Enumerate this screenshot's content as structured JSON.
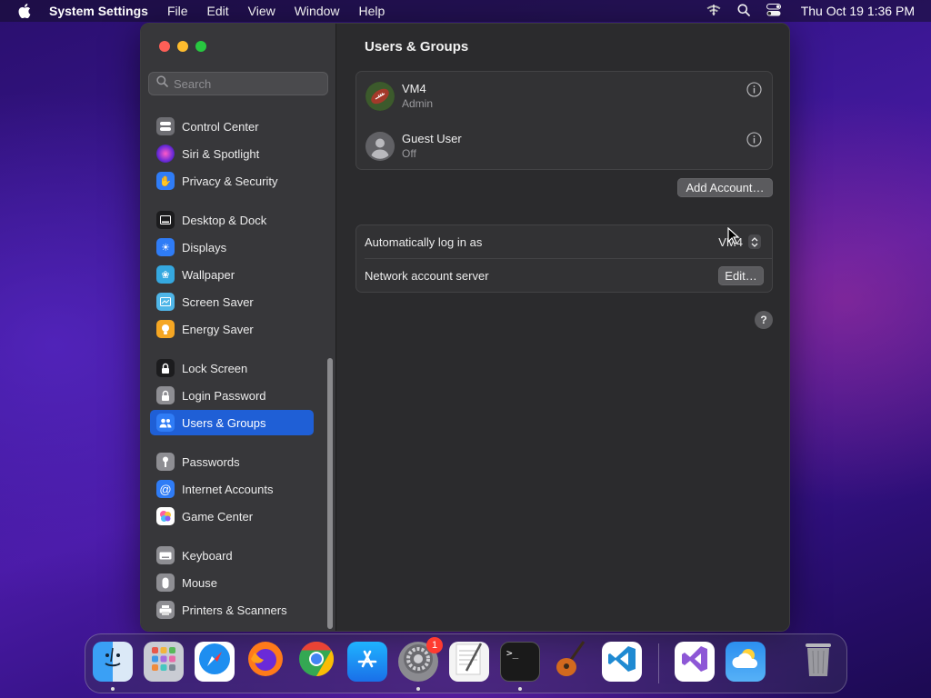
{
  "menubar": {
    "app_name": "System Settings",
    "items": [
      "File",
      "Edit",
      "View",
      "Window",
      "Help"
    ],
    "clock": "Thu Oct 19  1:36 PM"
  },
  "sidebar": {
    "search_placeholder": "Search",
    "items": [
      {
        "label": "Control Center",
        "icon": "control-center-icon",
        "color": "#6e6e73"
      },
      {
        "label": "Siri & Spotlight",
        "icon": "siri-icon",
        "color": "#b43bd8"
      },
      {
        "label": "Privacy & Security",
        "icon": "hand-icon",
        "color": "#2f7cf6"
      },
      {
        "label": "Desktop & Dock",
        "icon": "dock-icon",
        "color": "#1c1c1e"
      },
      {
        "label": "Displays",
        "icon": "sun-icon",
        "color": "#2f7cf6"
      },
      {
        "label": "Wallpaper",
        "icon": "flower-icon",
        "color": "#35a8e0"
      },
      {
        "label": "Screen Saver",
        "icon": "screen-saver-icon",
        "color": "#4fb6e8"
      },
      {
        "label": "Energy Saver",
        "icon": "bulb-icon",
        "color": "#f5a623"
      },
      {
        "label": "Lock Screen",
        "icon": "lock-icon",
        "color": "#1c1c1e"
      },
      {
        "label": "Login Password",
        "icon": "login-lock-icon",
        "color": "#8e8e93"
      },
      {
        "label": "Users & Groups",
        "icon": "users-icon",
        "color": "#2f7cf6"
      },
      {
        "label": "Passwords",
        "icon": "key-icon",
        "color": "#8e8e93"
      },
      {
        "label": "Internet Accounts",
        "icon": "at-icon",
        "color": "#2f7cf6"
      },
      {
        "label": "Game Center",
        "icon": "game-center-icon",
        "color": "#ffffff"
      },
      {
        "label": "Keyboard",
        "icon": "keyboard-icon",
        "color": "#8e8e93"
      },
      {
        "label": "Mouse",
        "icon": "mouse-icon",
        "color": "#8e8e93"
      },
      {
        "label": "Printers & Scanners",
        "icon": "printer-icon",
        "color": "#8e8e93"
      }
    ],
    "active": "Users & Groups"
  },
  "content": {
    "title": "Users & Groups",
    "users": [
      {
        "name": "VM4",
        "role": "Admin"
      },
      {
        "name": "Guest User",
        "role": "Off"
      }
    ],
    "add_account_label": "Add Account…",
    "auto_login_label": "Automatically log in as",
    "auto_login_value": "VM4",
    "network_server_label": "Network account server",
    "edit_label": "Edit…",
    "help_label": "?"
  },
  "dock": {
    "apps": [
      "Finder",
      "Launchpad",
      "Safari",
      "Firefox",
      "Chrome",
      "App Store",
      "System Settings",
      "TextEdit",
      "Terminal",
      "GarageBand",
      "VS Code",
      "Visual Studio",
      "Weather",
      "Trash"
    ],
    "settings_badge": "1"
  },
  "colors": {
    "accent": "#1f5fd6",
    "window_bg": "#2b2b2d",
    "sidebar_bg": "#37373a"
  }
}
